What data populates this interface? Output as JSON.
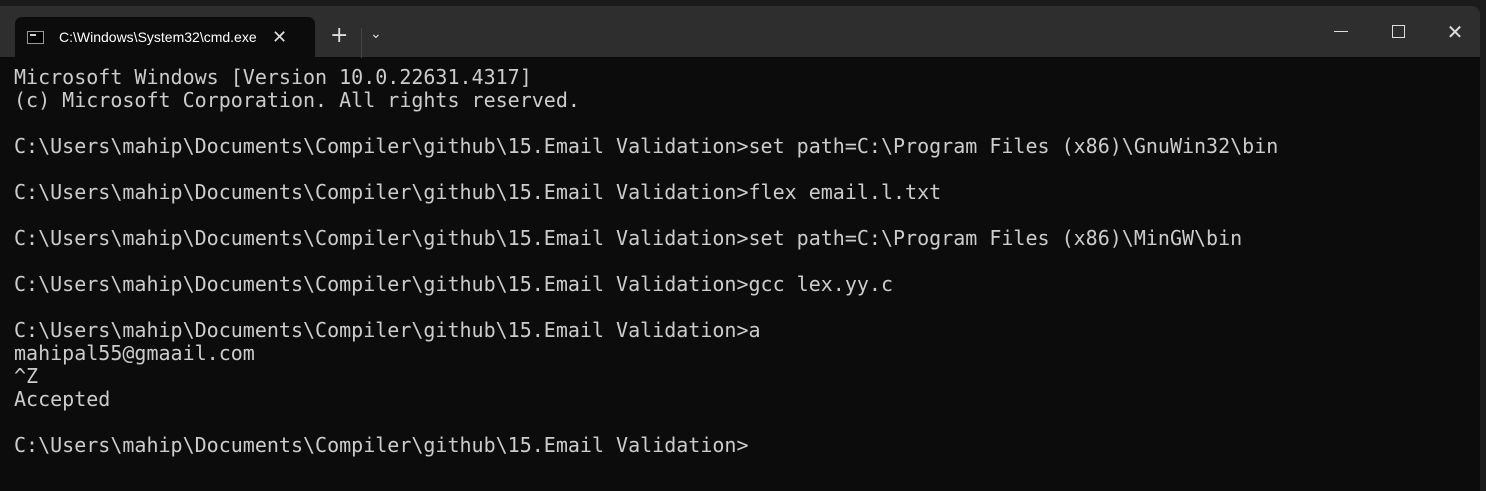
{
  "tab": {
    "title": "C:\\Windows\\System32\\cmd.exe",
    "close": "✕"
  },
  "titlebar": {
    "new_tab": "+",
    "dropdown": "⌄",
    "close": "✕"
  },
  "terminal": {
    "lines": [
      "Microsoft Windows [Version 10.0.22631.4317]",
      "(c) Microsoft Corporation. All rights reserved.",
      "",
      "C:\\Users\\mahip\\Documents\\Compiler\\github\\15.Email Validation>set path=C:\\Program Files (x86)\\GnuWin32\\bin",
      "",
      "C:\\Users\\mahip\\Documents\\Compiler\\github\\15.Email Validation>flex email.l.txt",
      "",
      "C:\\Users\\mahip\\Documents\\Compiler\\github\\15.Email Validation>set path=C:\\Program Files (x86)\\MinGW\\bin",
      "",
      "C:\\Users\\mahip\\Documents\\Compiler\\github\\15.Email Validation>gcc lex.yy.c",
      "",
      "C:\\Users\\mahip\\Documents\\Compiler\\github\\15.Email Validation>a",
      "mahipal55@gmaail.com",
      "^Z",
      "Accepted",
      "",
      "C:\\Users\\mahip\\Documents\\Compiler\\github\\15.Email Validation>"
    ]
  }
}
